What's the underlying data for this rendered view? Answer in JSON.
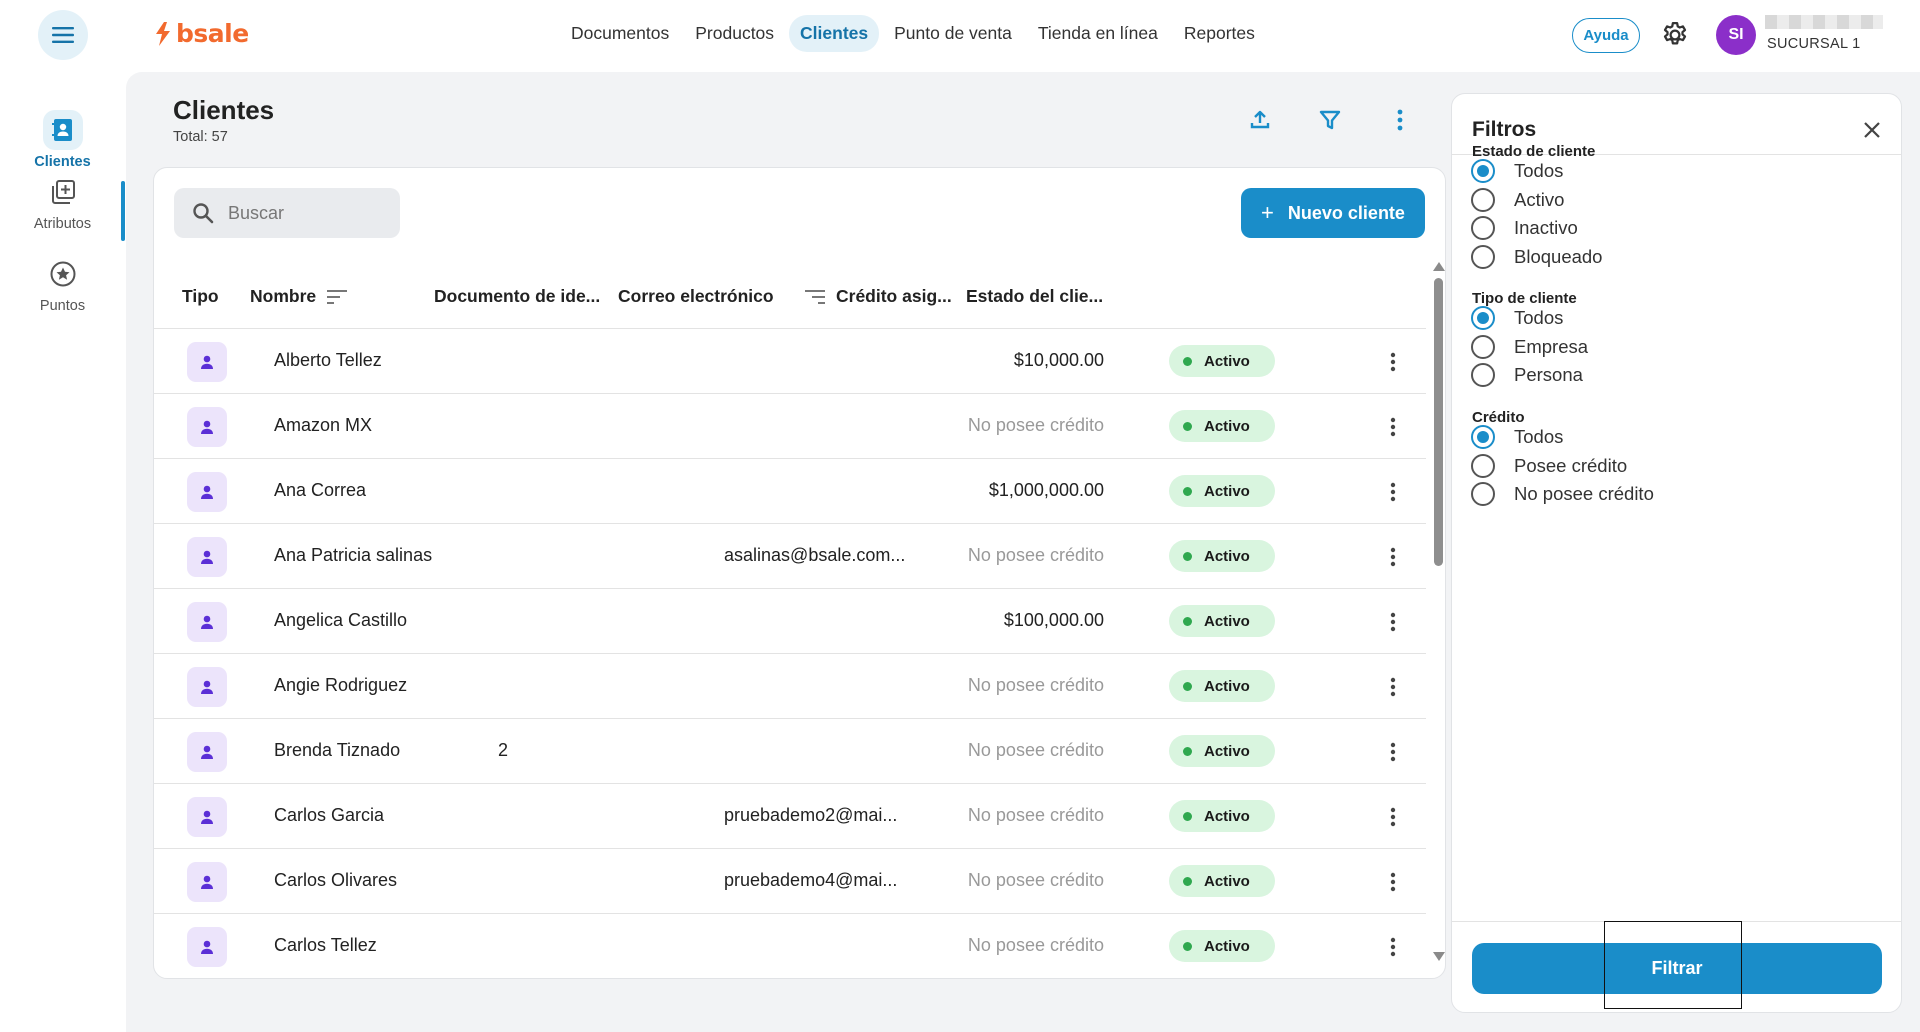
{
  "topbar": {
    "brand": "bsale",
    "nav": [
      "Documentos",
      "Productos",
      "Clientes",
      "Punto de venta",
      "Tienda en línea",
      "Reportes"
    ],
    "nav_active": "Clientes",
    "help_label": "Ayuda",
    "avatar_initials": "SI",
    "branch": "SUCURSAL 1"
  },
  "sidebar": {
    "items": [
      {
        "label": "Clientes",
        "icon": "contacts-icon",
        "active": true
      },
      {
        "label": "Atributos",
        "icon": "add-library-icon",
        "active": false
      },
      {
        "label": "Puntos",
        "icon": "star-circle-icon",
        "active": false
      }
    ]
  },
  "page": {
    "title": "Clientes",
    "total": "Total: 57"
  },
  "search": {
    "placeholder": "Buscar"
  },
  "new_client_label": "Nuevo cliente",
  "table": {
    "columns": [
      "Tipo",
      "Nombre",
      "Documento de ide...",
      "Correo electrónico",
      "Crédito asig...",
      "Estado del clie..."
    ],
    "rows": [
      {
        "name": "Alberto Tellez",
        "doc": "",
        "email": "",
        "credit": "$10,000.00",
        "status": "Activo"
      },
      {
        "name": "Amazon MX",
        "doc": "",
        "email": "",
        "credit": "No posee crédito",
        "status": "Activo"
      },
      {
        "name": "Ana Correa",
        "doc": "",
        "email": "",
        "credit": "$1,000,000.00",
        "status": "Activo"
      },
      {
        "name": "Ana Patricia salinas",
        "doc": "",
        "email": "asalinas@bsale.com...",
        "credit": "No posee crédito",
        "status": "Activo"
      },
      {
        "name": "Angelica Castillo",
        "doc": "",
        "email": "",
        "credit": "$100,000.00",
        "status": "Activo"
      },
      {
        "name": "Angie Rodriguez",
        "doc": "",
        "email": "",
        "credit": "No posee crédito",
        "status": "Activo"
      },
      {
        "name": "Brenda Tiznado",
        "doc": "2",
        "email": "",
        "credit": "No posee crédito",
        "status": "Activo"
      },
      {
        "name": "Carlos Garcia",
        "doc": "",
        "email": "pruebademo2@mai...",
        "credit": "No posee crédito",
        "status": "Activo"
      },
      {
        "name": "Carlos Olivares",
        "doc": "",
        "email": "pruebademo4@mai...",
        "credit": "No posee crédito",
        "status": "Activo"
      },
      {
        "name": "Carlos Tellez",
        "doc": "",
        "email": "",
        "credit": "No posee crédito",
        "status": "Activo"
      }
    ]
  },
  "filters": {
    "title": "Filtros",
    "groups": [
      {
        "title": "Estado de cliente",
        "options": [
          "Todos",
          "Activo",
          "Inactivo",
          "Bloqueado"
        ],
        "selected": "Todos"
      },
      {
        "title": "Tipo de cliente",
        "options": [
          "Todos",
          "Empresa",
          "Persona"
        ],
        "selected": "Todos"
      },
      {
        "title": "Crédito",
        "options": [
          "Todos",
          "Posee crédito",
          "No posee crédito"
        ],
        "selected": "Todos"
      }
    ],
    "apply_label": "Filtrar"
  },
  "colors": {
    "accent": "#1a8dc9",
    "brand": "#f26a2e",
    "status_active_bg": "#d9f5df",
    "status_active_dot": "#2fa84f"
  }
}
